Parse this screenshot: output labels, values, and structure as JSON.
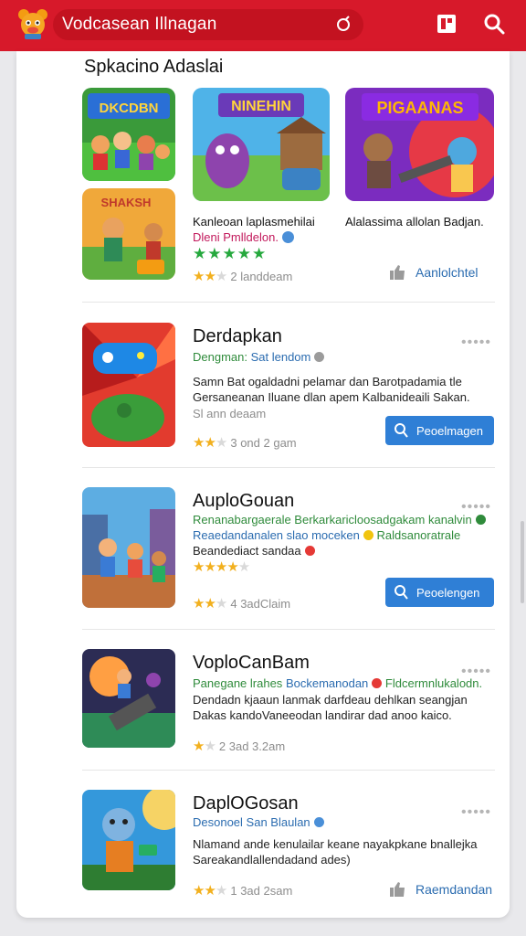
{
  "header": {
    "search_text": "Vodcasean Illnagan"
  },
  "section": {
    "title": "Spkacino Adaslai"
  },
  "featured": {
    "left_name": "Kanleoan laplasmehilai",
    "left_sub": "Dleni Pmlldelon.",
    "left_rating": "2 landdeam",
    "right_name": "Alalassima allolan Badjan.",
    "right_link": "Aanlolchtel",
    "art_top_center": "NINEHIN",
    "art_top_right": "PIGAANAS",
    "art_top_left": "DKCDBN",
    "art_bottom_left": "SHAKSH"
  },
  "items": [
    {
      "title": "Derdapkan",
      "sub_a": "Dengman:",
      "sub_b": "Sat lendom",
      "desc": "Samn Bat ogaldadni pelamar dan Barotpadamia tle Gersaneanan Iluane dlan apem Kalbanideaili Sakan.",
      "note": "Sl ann deaam",
      "rating": "3 ond 2 gam",
      "button": "Peoelmagen",
      "colors": {
        "sub_dot": "#9b9b9b"
      }
    },
    {
      "title": "AuploGouan",
      "sub_a": "Renanabargaerale Berkarkaricloosadgakam kanalvin",
      "sub_b": "Reaedandanalen slao moceken",
      "sub_c": "Raldsanoratrale",
      "desc": "Beandediact sandaa",
      "rating": "4 3adClaim",
      "button": "Peoelengen",
      "colors": {
        "sub_dot": "#2f8b3b"
      }
    },
    {
      "title": "VoploCanBam",
      "sub_a": "Panegane lrahes",
      "sub_b": "Bockemanodan",
      "sub_c": "Fldcermnlukalodn.",
      "desc": "Dendadn kjaaun lanmak darfdeau dehlkan seangjan Dakas kandoVaneeodan landirar dad anoo kaico.",
      "rating": "2 3ad 3.2am"
    },
    {
      "title": "DaplOGosan",
      "sub_a": "Desonoel San Blaulan",
      "desc": "Nlamand ande kenulailar keane nayakpkane bnallejka Sareakandlallendadand ades)",
      "rating": "1 3ad 2sam",
      "link": "Raemdandan"
    }
  ]
}
